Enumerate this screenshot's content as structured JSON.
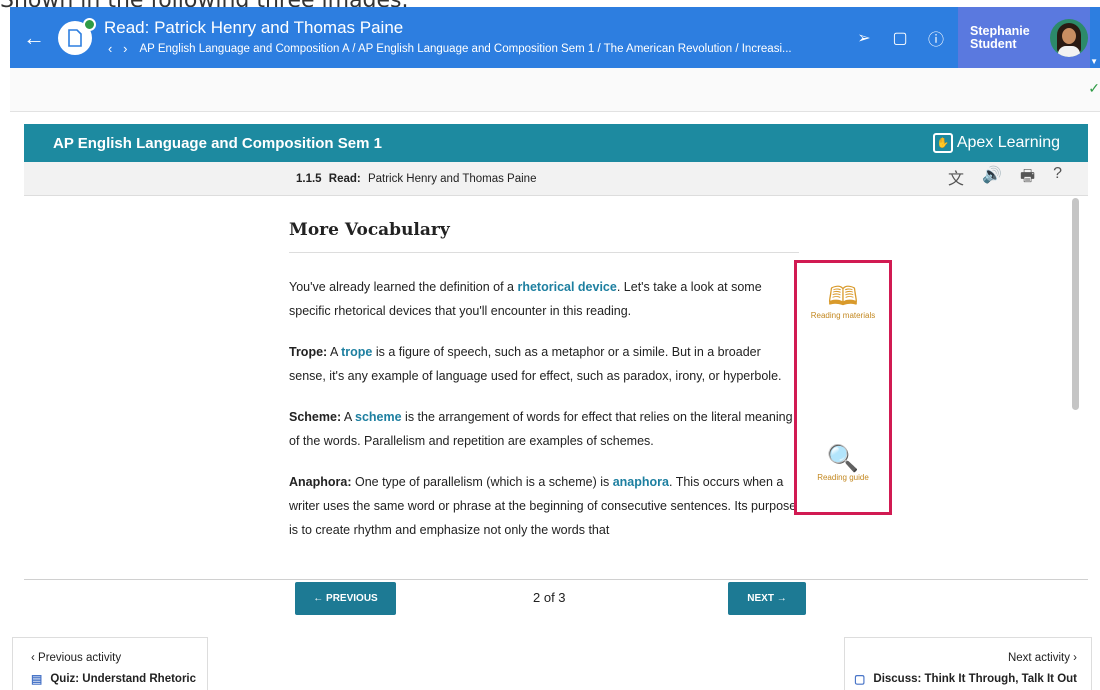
{
  "caption": "Shown in the following three images.",
  "header": {
    "title": "Read: Patrick Henry and Thomas Paine",
    "breadcrumb": "AP English Language and Composition A / AP English Language and Composition Sem 1 / The American Revolution / Increasi...",
    "user_name": "Stephanie Student"
  },
  "banner": {
    "course": "AP English Language and Composition Sem 1",
    "logo_text": "Apex Learning"
  },
  "activity": {
    "number": "1.1.5",
    "type": "Read:",
    "name": "Patrick Henry and Thomas Paine"
  },
  "article": {
    "heading": "More Vocabulary",
    "p1": {
      "a": "You've already learned the definition of a ",
      "term": "rhetorical device",
      "b": ". Let's take a look at some specific rhetorical devices that you'll encounter in this reading."
    },
    "p2": {
      "label": "Trope:",
      "a": " A ",
      "term": "trope",
      "b": " is a figure of speech, such as a metaphor or a simile. But in a broader sense, it's any example of language used for effect, such as paradox, irony, or hyperbole."
    },
    "p3": {
      "label": "Scheme:",
      "a": " A ",
      "term": "scheme",
      "b": " is the arrangement of words for effect that relies on the literal meaning of the words. Parallelism and repetition are examples of schemes."
    },
    "p4": {
      "label": "Anaphora:",
      "a": " One type of parallelism (which is a scheme) is ",
      "term": "anaphora",
      "b": ". This occurs when a writer uses the same word or phrase at the beginning of consecutive sentences. Its purpose is to create rhythm and emphasize not only the words that"
    }
  },
  "resources": {
    "reading_materials": "Reading materials",
    "reading_guide": "Reading guide"
  },
  "pager": {
    "previous": "← PREVIOUS",
    "next": "NEXT →",
    "count": "2 of 3"
  },
  "nav": {
    "prev_label": "Previous activity",
    "prev_name": "Quiz: Understand Rhetoric",
    "next_label": "Next activity",
    "next_name": "Discuss: Think It Through, Talk It Out"
  },
  "colors": {
    "header_blue": "#2d7ee0",
    "banner_teal": "#1d8aa0",
    "highlight": "#d11a52",
    "resource_gold": "#d99a2b"
  }
}
